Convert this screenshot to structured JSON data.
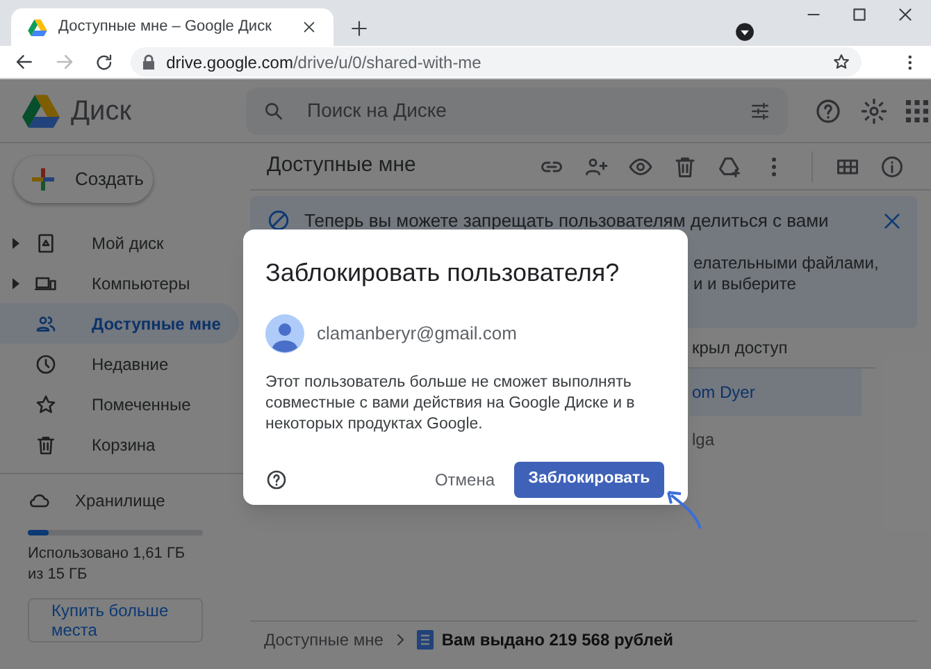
{
  "browser": {
    "tab_title": "Доступные мне – Google Диск",
    "url_host": "drive.google.com",
    "url_path": "/drive/u/0/shared-with-me"
  },
  "header": {
    "logo_text": "Диск",
    "search": {
      "placeholder": "Поиск на Диске"
    }
  },
  "sidebar": {
    "create_button": "Создать",
    "items": [
      {
        "label": "Мой диск",
        "expandable": true,
        "selected": false
      },
      {
        "label": "Компьютеры",
        "expandable": true,
        "selected": false
      },
      {
        "label": "Доступные мне",
        "expandable": false,
        "selected": true
      },
      {
        "label": "Недавние",
        "expandable": false,
        "selected": false
      },
      {
        "label": "Помеченные",
        "expandable": false,
        "selected": false
      },
      {
        "label": "Корзина",
        "expandable": false,
        "selected": false
      }
    ],
    "storage": {
      "label": "Хранилище",
      "level": 0.12,
      "usage": "Использовано 1,61 ГБ из 15 ГБ",
      "buy_button": "Купить больше места"
    }
  },
  "main": {
    "title": "Доступные мне",
    "banner": {
      "title": "Теперь вы можете запрещать пользователям делиться с вами",
      "line_2": "елательными файлами,",
      "line_3": "и и выберите"
    },
    "column_header": "крыл доступ",
    "rows": [
      {
        "label": "om Dyer",
        "selected": true
      },
      {
        "label": "lga",
        "selected": false
      }
    ],
    "breadcrumb": [
      "Доступные мне",
      "Вам выдано 219 568 рублей"
    ]
  },
  "dialog": {
    "title": "Заблокировать пользователя?",
    "email": "clamanberyr@gmail.com",
    "message": "Этот пользователь больше не сможет выполнять совместные с вами действия на Google Диске и в некоторых продуктах Google.",
    "cancel_button": "Отмена",
    "confirm_button": "Заблокировать"
  }
}
